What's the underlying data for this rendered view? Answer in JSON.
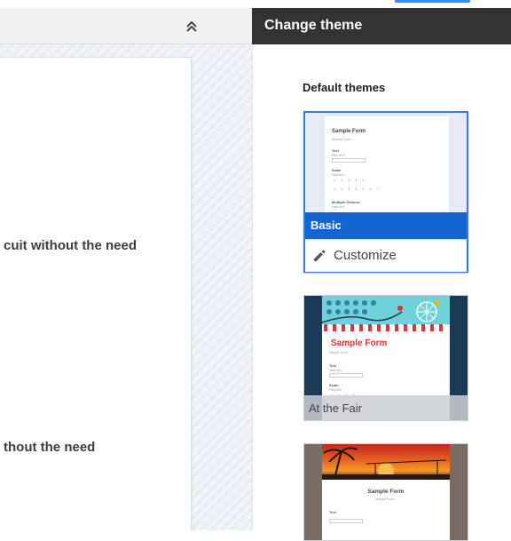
{
  "panel": {
    "title": "Change theme",
    "section_label": "Default themes"
  },
  "form_fragments": [
    "cuit without the need",
    "thout the need"
  ],
  "themes": [
    {
      "name": "Basic",
      "selected": true,
      "action_label": "Customize",
      "preview": {
        "title": "Sample Form",
        "subtitle": "Sample Form...",
        "fields": [
          "Text",
          "Scale",
          "Multiple Choices"
        ],
        "help": "Help text",
        "scale_row_1": "1 2 3 4 5",
        "scale_row_2": "1 2 3 4 5 6 7"
      }
    },
    {
      "name": "At the Fair",
      "preview": {
        "title": "Sample Form",
        "subtitle": "Sample Form...",
        "fields": [
          "Text",
          "Scale"
        ],
        "help": "Help text",
        "scale_row": "1 2 3 4",
        "extra": "Multiple Choices"
      }
    },
    {
      "name": "",
      "preview": {
        "title": "Sample Form",
        "subtitle": "Sample Form...",
        "fields": [
          "Text"
        ]
      }
    }
  ],
  "colors": {
    "header_bg": "#333333",
    "selected_border": "#3b78e7",
    "basic_banner": "#1565d0",
    "fair_title": "#d93636",
    "fair_bg": "#1b3a57"
  },
  "icons": [
    "chevron-double-up-icon",
    "pencil-icon"
  ]
}
